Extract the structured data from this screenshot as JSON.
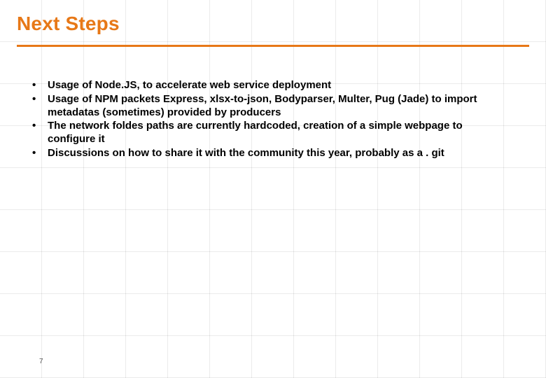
{
  "slide": {
    "title": "Next Steps",
    "accent_color": "#e77817",
    "bullets": [
      "Usage of Node.JS, to accelerate web service deployment",
      "Usage of NPM packets Express, xlsx-to-json, Bodyparser, Multer, Pug (Jade) to import metadatas (sometimes) provided by producers",
      "The network foldes paths are currently hardcoded, creation of a simple webpage to configure it",
      "Discussions on how to share it with the community this year, probably as a . git"
    ],
    "page_number": "7"
  }
}
